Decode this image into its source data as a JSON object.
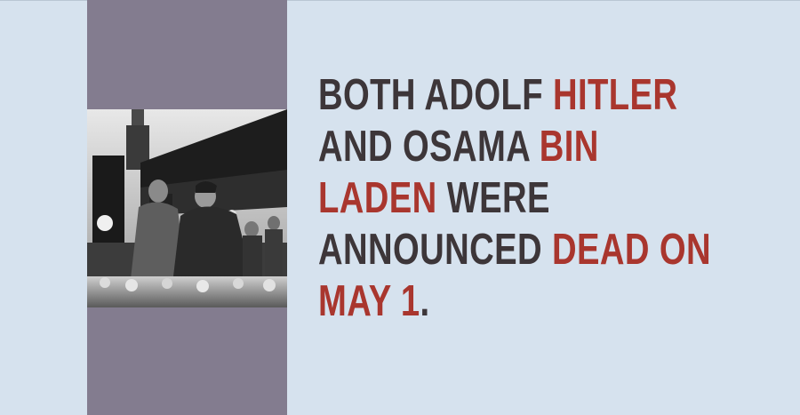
{
  "colors": {
    "background": "#d6e2ee",
    "side_band": "#837c8f",
    "text_dark": "#3d3639",
    "text_highlight": "#a9362e"
  },
  "photo": {
    "description_icon": "historical-photo"
  },
  "fact": {
    "line1_a": "BOTH ADOLF ",
    "line1_b": "HITLER",
    "line2_a": "AND OSAMA ",
    "line2_b": "BIN",
    "line3_a": "LADEN",
    "line3_b": " WERE",
    "line4_a": "ANNOUNCED ",
    "line4_b": "DEAD ON",
    "line5_a": "MAY 1",
    "line5_b": "."
  }
}
